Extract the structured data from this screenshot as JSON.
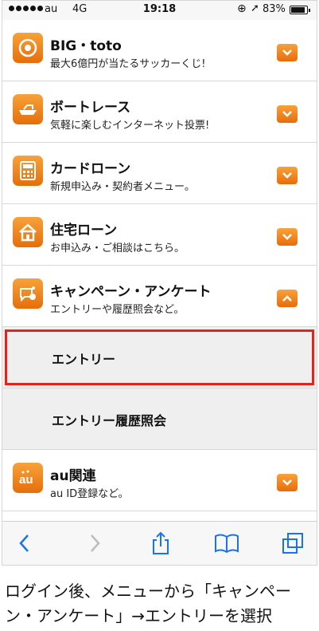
{
  "status_bar": {
    "carrier": "au",
    "network": "4G",
    "time": "19:18",
    "battery_percent": "83%",
    "battery_level": 0.83,
    "lock_icon": "rotation-lock-icon",
    "location_icon": "location-arrow-icon"
  },
  "menu": {
    "items": [
      {
        "title": "BIG・toto",
        "subtitle": "最大6億円が当たるサッカーくじ!",
        "icon": "soccer-ball-icon",
        "state": "collapsed"
      },
      {
        "title": "ボートレース",
        "subtitle": "気軽に楽しむインターネット投票!",
        "icon": "boat-icon",
        "state": "collapsed"
      },
      {
        "title": "カードローン",
        "subtitle": "新規申込み・契約者メニュー。",
        "icon": "calculator-icon",
        "state": "collapsed"
      },
      {
        "title": "住宅ローン",
        "subtitle": "お申込み・ご相談はこちら。",
        "icon": "house-icon",
        "state": "collapsed"
      },
      {
        "title": "キャンペーン・アンケート",
        "subtitle": "エントリーや履歴照会など。",
        "icon": "campaign-icon",
        "state": "expanded"
      },
      {
        "title": "au関連",
        "subtitle": "au ID登録など。",
        "icon": "au-logo-icon",
        "state": "collapsed"
      }
    ],
    "submenu": [
      {
        "label": "エントリー",
        "highlighted": true
      },
      {
        "label": "エントリー履歴照会",
        "highlighted": false
      }
    ]
  },
  "toolbar": {
    "back_icon": "back-chevron-icon",
    "forward_icon": "forward-chevron-icon",
    "share_icon": "share-icon",
    "bookmarks_icon": "book-icon",
    "tabs_icon": "tabs-icon"
  },
  "colors": {
    "accent_orange": "#ec7a12",
    "highlight_red": "#e0241e"
  },
  "caption": "ログイン後、メニューから「キャンペーン・アンケート」→エントリーを選択"
}
